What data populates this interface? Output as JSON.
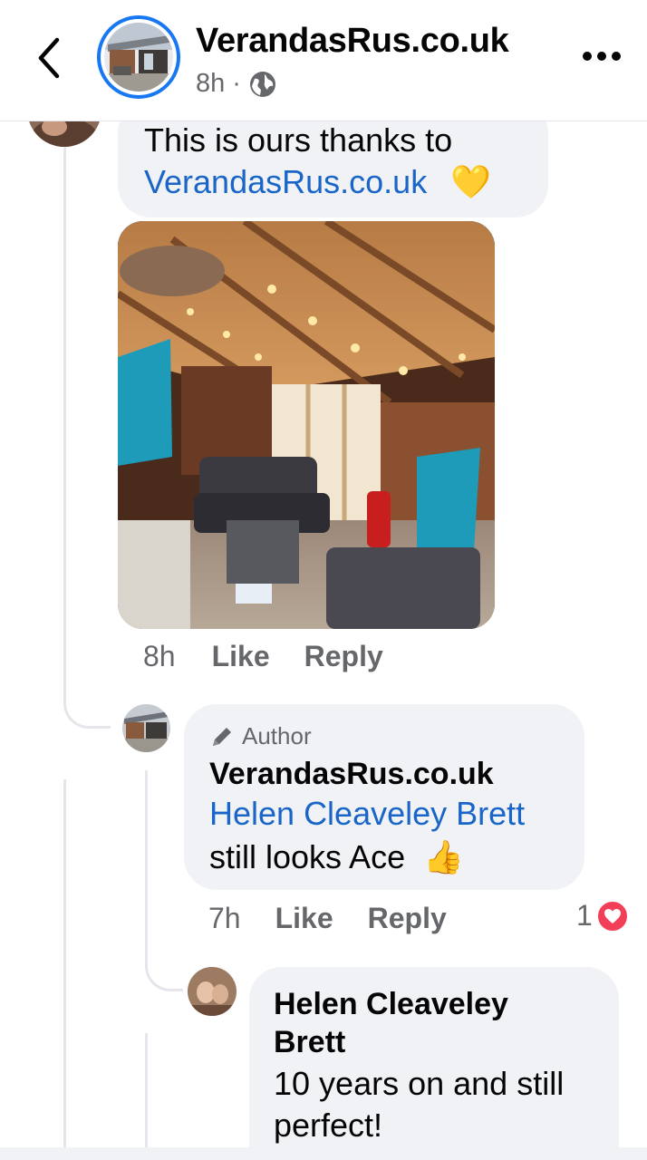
{
  "header": {
    "page_name": "VerandasRus.co.uk",
    "time": "8h",
    "separator": "·"
  },
  "comment1": {
    "text_line1": "This is ours thanks to",
    "link": "VerandasRus.co.uk",
    "emoji": "💛",
    "time": "8h",
    "like_label": "Like",
    "reply_label": "Reply"
  },
  "reply1": {
    "author_tag": "Author",
    "name": "VerandasRus.co.uk",
    "mention": "Helen Cleaveley Brett",
    "text": "still looks Ace",
    "emoji": "👍",
    "time": "7h",
    "like_label": "Like",
    "reply_label": "Reply",
    "reaction_count": "1"
  },
  "reply2": {
    "name_line1": "Helen Cleaveley",
    "name_line2": "Brett",
    "text_line1": "10 years on and still",
    "text_line2": "perfect!"
  },
  "icons": {
    "back": "back-arrow-icon",
    "globe": "globe-icon",
    "more": "more-icon",
    "pencil": "pencil-icon",
    "heart": "heart-icon"
  },
  "colors": {
    "accent": "#1877f2",
    "link": "#1a66c8",
    "bubble": "#f0f2f5",
    "secondary_text": "#65676b",
    "heart": "#f33e58"
  }
}
